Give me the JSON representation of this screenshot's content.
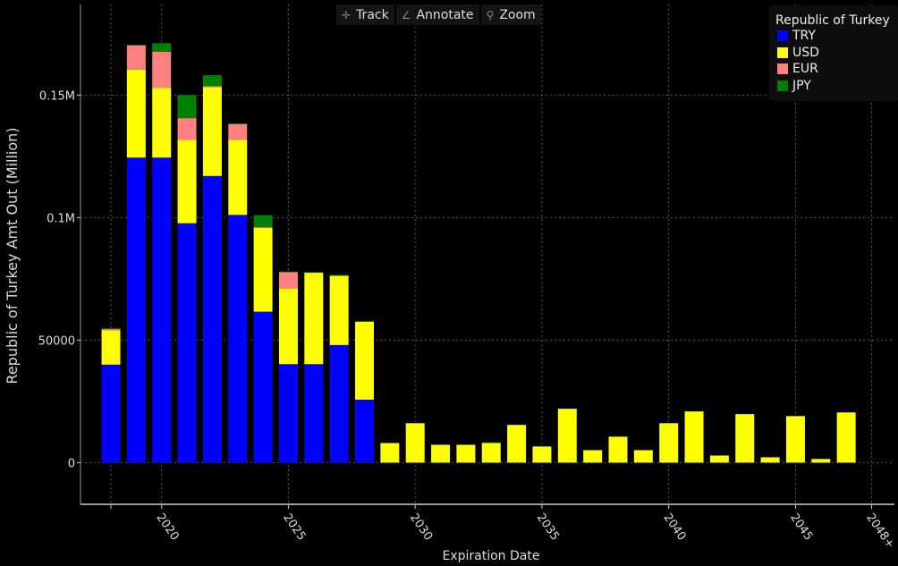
{
  "toolbar": {
    "track": "Track",
    "annotate": "Annotate",
    "zoom": "Zoom"
  },
  "legend": {
    "title": "Republic of Turkey"
  },
  "chart_data": {
    "type": "bar",
    "stacked": true,
    "title": "",
    "xlabel": "Expiration Date",
    "ylabel": "Republic of Turkey Amt Out (Million)",
    "ylim": [
      -17000,
      187000
    ],
    "xlim": [
      2016.8,
      2048.9
    ],
    "yticks": [
      {
        "v": 0,
        "label": "0"
      },
      {
        "v": 50000,
        "label": "50000"
      },
      {
        "v": 100000,
        "label": "0.1M"
      },
      {
        "v": 150000,
        "label": "0.15M"
      }
    ],
    "xticks": [
      {
        "v": 2018,
        "label": ""
      },
      {
        "v": 2020,
        "label": "2020"
      },
      {
        "v": 2025,
        "label": "2025"
      },
      {
        "v": 2030,
        "label": "2030"
      },
      {
        "v": 2035,
        "label": "2035"
      },
      {
        "v": 2040,
        "label": "2040"
      },
      {
        "v": 2045,
        "label": "2045"
      },
      {
        "v": 2048,
        "label": "2048+"
      }
    ],
    "grid": true,
    "legend_placement": "top-right",
    "x": [
      2018,
      2019,
      2020,
      2021,
      2022,
      2023,
      2024,
      2025,
      2026,
      2027,
      2028,
      2029,
      2030,
      2031,
      2032,
      2033,
      2034,
      2035,
      2036,
      2037,
      2038,
      2039,
      2040,
      2041,
      2042,
      2043,
      2044,
      2045,
      2046,
      2047
    ],
    "series": [
      {
        "name": "TRY",
        "color": "#0000ff",
        "values": [
          40000,
          124500,
          124500,
          97700,
          117000,
          101100,
          61600,
          40200,
          40200,
          48000,
          25700,
          0,
          0,
          0,
          0,
          0,
          0,
          0,
          0,
          0,
          0,
          0,
          0,
          0,
          0,
          0,
          0,
          0,
          0,
          0
        ]
      },
      {
        "name": "USD",
        "color": "#ffff00",
        "values": [
          14000,
          35900,
          28500,
          34000,
          36300,
          30600,
          34200,
          30900,
          37300,
          28300,
          31800,
          8000,
          16100,
          7300,
          7300,
          8000,
          15400,
          6600,
          22000,
          5100,
          10600,
          5100,
          16100,
          20900,
          2900,
          19800,
          2200,
          19000,
          1500,
          20500
        ]
      },
      {
        "name": "EUR",
        "color": "#ff8080",
        "values": [
          500,
          9900,
          14700,
          8900,
          400,
          6500,
          300,
          6600,
          0,
          0,
          0,
          0,
          0,
          0,
          0,
          0,
          0,
          0,
          0,
          0,
          0,
          0,
          0,
          0,
          0,
          0,
          0,
          0,
          0,
          0
        ]
      },
      {
        "name": "JPY",
        "color": "#008000",
        "values": [
          300,
          300,
          3500,
          9400,
          4400,
          300,
          4900,
          300,
          300,
          300,
          300,
          0,
          0,
          0,
          0,
          300,
          0,
          0,
          0,
          0,
          0,
          0,
          0,
          0,
          0,
          0,
          0,
          0,
          0,
          0
        ]
      }
    ]
  }
}
